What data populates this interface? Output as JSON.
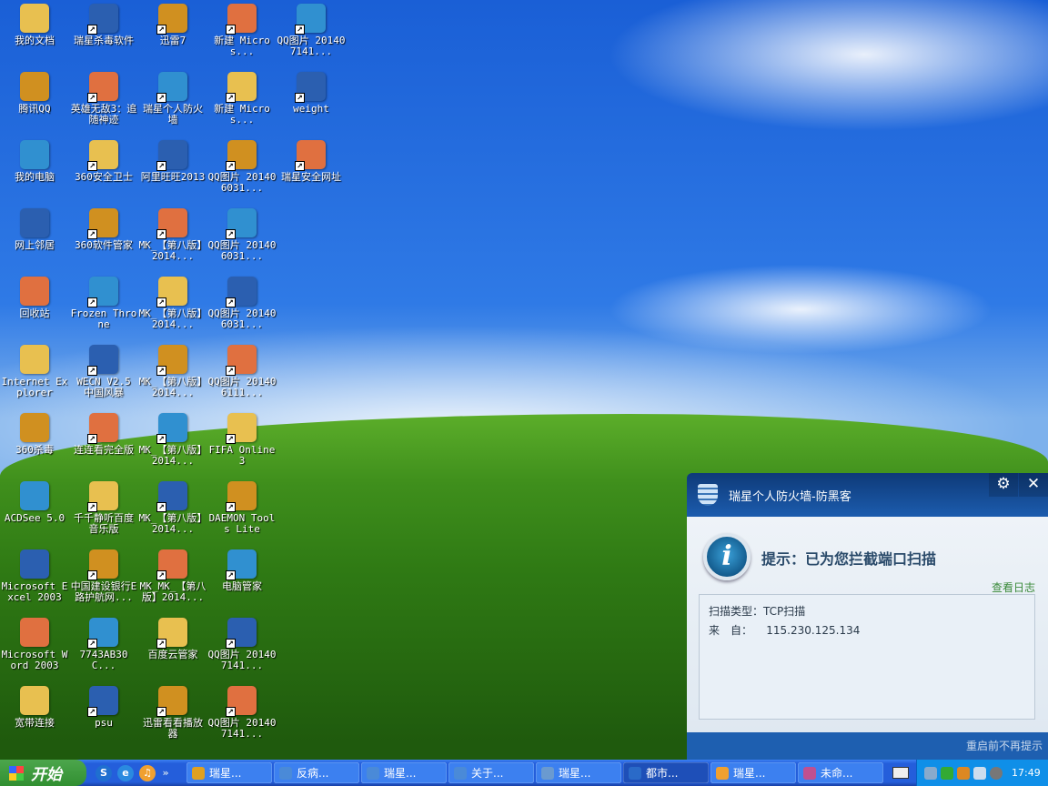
{
  "desktop": {
    "icons": [
      [
        "我的文档",
        "瑞星杀毒软件",
        "迅雷7",
        "新建 Micros...",
        "QQ图片 201407141..."
      ],
      [
        "腾讯QQ",
        "英雄无敌3：追随神迹",
        "瑞星个人防火墙",
        "新建 Micros...",
        "weight"
      ],
      [
        "我的电脑",
        "360安全卫士",
        "阿里旺旺2013",
        "QQ图片 201406031...",
        "瑞星安全网址"
      ],
      [
        "网上邻居",
        "360软件管家",
        "MK_【第八版】2014...",
        "QQ图片 201406031..."
      ],
      [
        "回收站",
        "Frozen Throne",
        "MK_【第八版】2014...",
        "QQ图片 201406031..."
      ],
      [
        "Internet Explorer",
        "WECN V2.5 中国风暴",
        "MK_【第八版】2014...",
        "QQ图片 201406111..."
      ],
      [
        "360杀毒",
        "连连看完全版",
        "MK_【第八版】2014...",
        "FIFA Online 3"
      ],
      [
        "ACDSee 5.0",
        "千千静听百度音乐版",
        "MK_【第八版】2014...",
        "DAEMON Tools Lite"
      ],
      [
        "Microsoft Excel 2003",
        "中国建设银行E路护航网...",
        "MK_MK_【第八版】2014...",
        "电脑管家"
      ],
      [
        "Microsoft Word 2003",
        "7743AB30C...",
        "百度云管家",
        "QQ图片 201407141..."
      ],
      [
        "宽带连接",
        "psu",
        "迅雷看看播放器",
        "QQ图片 201407141..."
      ]
    ]
  },
  "popup": {
    "title": "瑞星个人防火墙-防黑客",
    "settings_icon": "⚙",
    "close_icon": "✕",
    "message": "提示：已为您拦截端口扫描",
    "view_log": "查看日志",
    "scan_type_label": "扫描类型：",
    "scan_type_value": "TCP扫描",
    "from_label": "来　自：",
    "from_value": "115.230.125.134",
    "dont_remind": "重启前不再提示"
  },
  "taskbar": {
    "start": "开始",
    "quick_launch": [
      "S",
      "e",
      "♫"
    ],
    "more": "»",
    "tasks": [
      {
        "label": "瑞星...",
        "color": "#e0a020"
      },
      {
        "label": "反病...",
        "color": "#4a8ad8"
      },
      {
        "label": "瑞星...",
        "color": "#4a8ad8"
      },
      {
        "label": "关于...",
        "color": "#4a8ad8"
      },
      {
        "label": "瑞星...",
        "color": "#6a9ad0"
      },
      {
        "label": "都市...",
        "color": "#2a6ac8"
      },
      {
        "label": "瑞星...",
        "color": "#f0a030"
      },
      {
        "label": "未命...",
        "color": "#c05090"
      }
    ],
    "clock": "17:49"
  }
}
